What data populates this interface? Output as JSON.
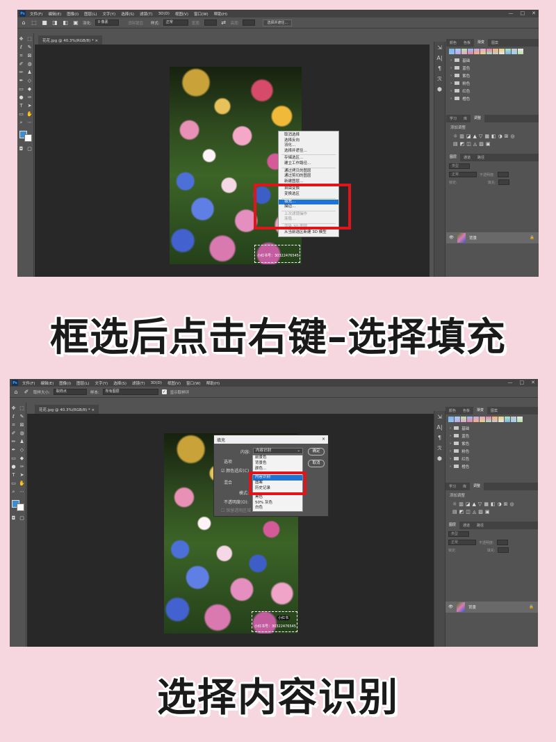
{
  "menu": [
    "文件(F)",
    "编辑(E)",
    "图像(I)",
    "图层(L)",
    "文字(Y)",
    "选择(S)",
    "滤镜(T)",
    "3D(D)",
    "视图(V)",
    "窗口(W)",
    "帮助(H)"
  ],
  "window_controls": [
    "—",
    "□",
    "✕"
  ],
  "shot1": {
    "options": {
      "feather_label": "羽化:",
      "feather_value": "0 像素",
      "antialias": "消除锯齿",
      "style_label": "样式:",
      "style_value": "正常",
      "width_label": "宽度:",
      "height_label": "高度:",
      "select_mask_button": "选择并遮住..."
    },
    "doc_tab": "花花.jpg @ 40.3%(RGB/8) *",
    "watermark": "小红书号：30322476545",
    "context_menu": [
      {
        "label": "取消选择",
        "state": "normal"
      },
      {
        "label": "选择反向",
        "state": "normal"
      },
      {
        "label": "羽化...",
        "state": "normal"
      },
      {
        "label": "选择并遮住...",
        "state": "normal"
      },
      {
        "sep": true
      },
      {
        "label": "存储选区...",
        "state": "normal"
      },
      {
        "label": "建立工作路径...",
        "state": "normal"
      },
      {
        "sep": true
      },
      {
        "label": "通过拷贝的图层",
        "state": "normal"
      },
      {
        "label": "通过剪切的图层",
        "state": "normal"
      },
      {
        "label": "新建图层...",
        "state": "normal"
      },
      {
        "sep": true
      },
      {
        "label": "自由变换",
        "state": "normal"
      },
      {
        "label": "变换选区",
        "state": "normal"
      },
      {
        "sep": true
      },
      {
        "label": "填充...",
        "state": "highlighted"
      },
      {
        "label": "描边...",
        "state": "normal"
      },
      {
        "sep": true
      },
      {
        "label": "上次滤镜操作",
        "state": "disabled"
      },
      {
        "label": "渐隐...",
        "state": "disabled"
      },
      {
        "sep": true
      },
      {
        "label": "渲染 3D 图层",
        "state": "disabled"
      },
      {
        "label": "从当前选区新建 3D 模型",
        "state": "normal"
      }
    ]
  },
  "shot2": {
    "options": {
      "sample_size_label": "取样大小:",
      "sample_size_value": "取样点",
      "sample_label": "样本:",
      "sample_value": "所有图层",
      "show_ring": "显示取样环"
    },
    "doc_tab": "花花.jpg @ 40.3%(RGB/8) *",
    "watermark": "小红书号：30322476545",
    "logo_badge": "小红书",
    "fill_dialog": {
      "title": "填充",
      "content_label": "内容:",
      "content_value": "内容识别",
      "options_label": "选项",
      "color_adapt_label": "颜色适应(C)",
      "blend_label": "混合",
      "mode_label": "模式:",
      "opacity_label": "不透明度(O):",
      "preserve_label": "保留透明区域",
      "ok_button": "确定",
      "cancel_button": "取消",
      "dropdown": [
        {
          "label": "前景色",
          "state": "normal"
        },
        {
          "label": "背景色",
          "state": "normal"
        },
        {
          "label": "颜色...",
          "state": "normal"
        },
        {
          "sep": true
        },
        {
          "label": "内容识别",
          "state": "highlighted"
        },
        {
          "label": "图案",
          "state": "normal"
        },
        {
          "label": "历史记录",
          "state": "normal"
        },
        {
          "sep": true
        },
        {
          "label": "黑色",
          "state": "normal"
        },
        {
          "label": "50% 灰色",
          "state": "normal"
        },
        {
          "label": "白色",
          "state": "normal"
        }
      ]
    }
  },
  "panels": {
    "top_tabs": [
      "颜色",
      "色板",
      "渐变",
      "图案"
    ],
    "active_top_tab": "渐变",
    "gradient_colors": [
      "#7fb6e6",
      "#9fd0ef",
      "#b6e1a4",
      "#8fc0f0",
      "#c3a7e6",
      "#e3a6d6",
      "#f07fa4",
      "#f3b07a",
      "#e6d37f",
      "#a9e3c3",
      "#c9c9c9",
      "#e8e8e8"
    ],
    "gradient_folders": [
      "基础",
      "蓝色",
      "紫色",
      "粉色",
      "红色",
      "橙色"
    ],
    "mid_tabs": [
      "学习",
      "库",
      "调整"
    ],
    "active_mid_tab": "调整",
    "adjust_title": "添加调整",
    "adjust_icons": [
      "☼",
      "▥",
      "◪",
      "▲",
      "▽",
      "▦",
      "◧",
      "◑",
      "⊞",
      "◎",
      "▤",
      "◩",
      "◫",
      "◬",
      "▨",
      "▣"
    ],
    "layer_tabs": [
      "图层",
      "通道",
      "路径"
    ],
    "layer_filter": "类型",
    "blend_mode": "正常",
    "opacity_label": "不透明度:",
    "lock_label": "锁定:",
    "fill_label": "填充:",
    "layer_name": "背景",
    "lock_icon": "🔒"
  },
  "captions": {
    "caption1": "框选后点击右键–选择填充",
    "caption2": "选择内容识别"
  },
  "colors": {
    "highlight": "#1e73d6",
    "red_box": "#e0141b",
    "page_bg": "#f6d6df",
    "fg_swatch": "#3d8ed0"
  }
}
